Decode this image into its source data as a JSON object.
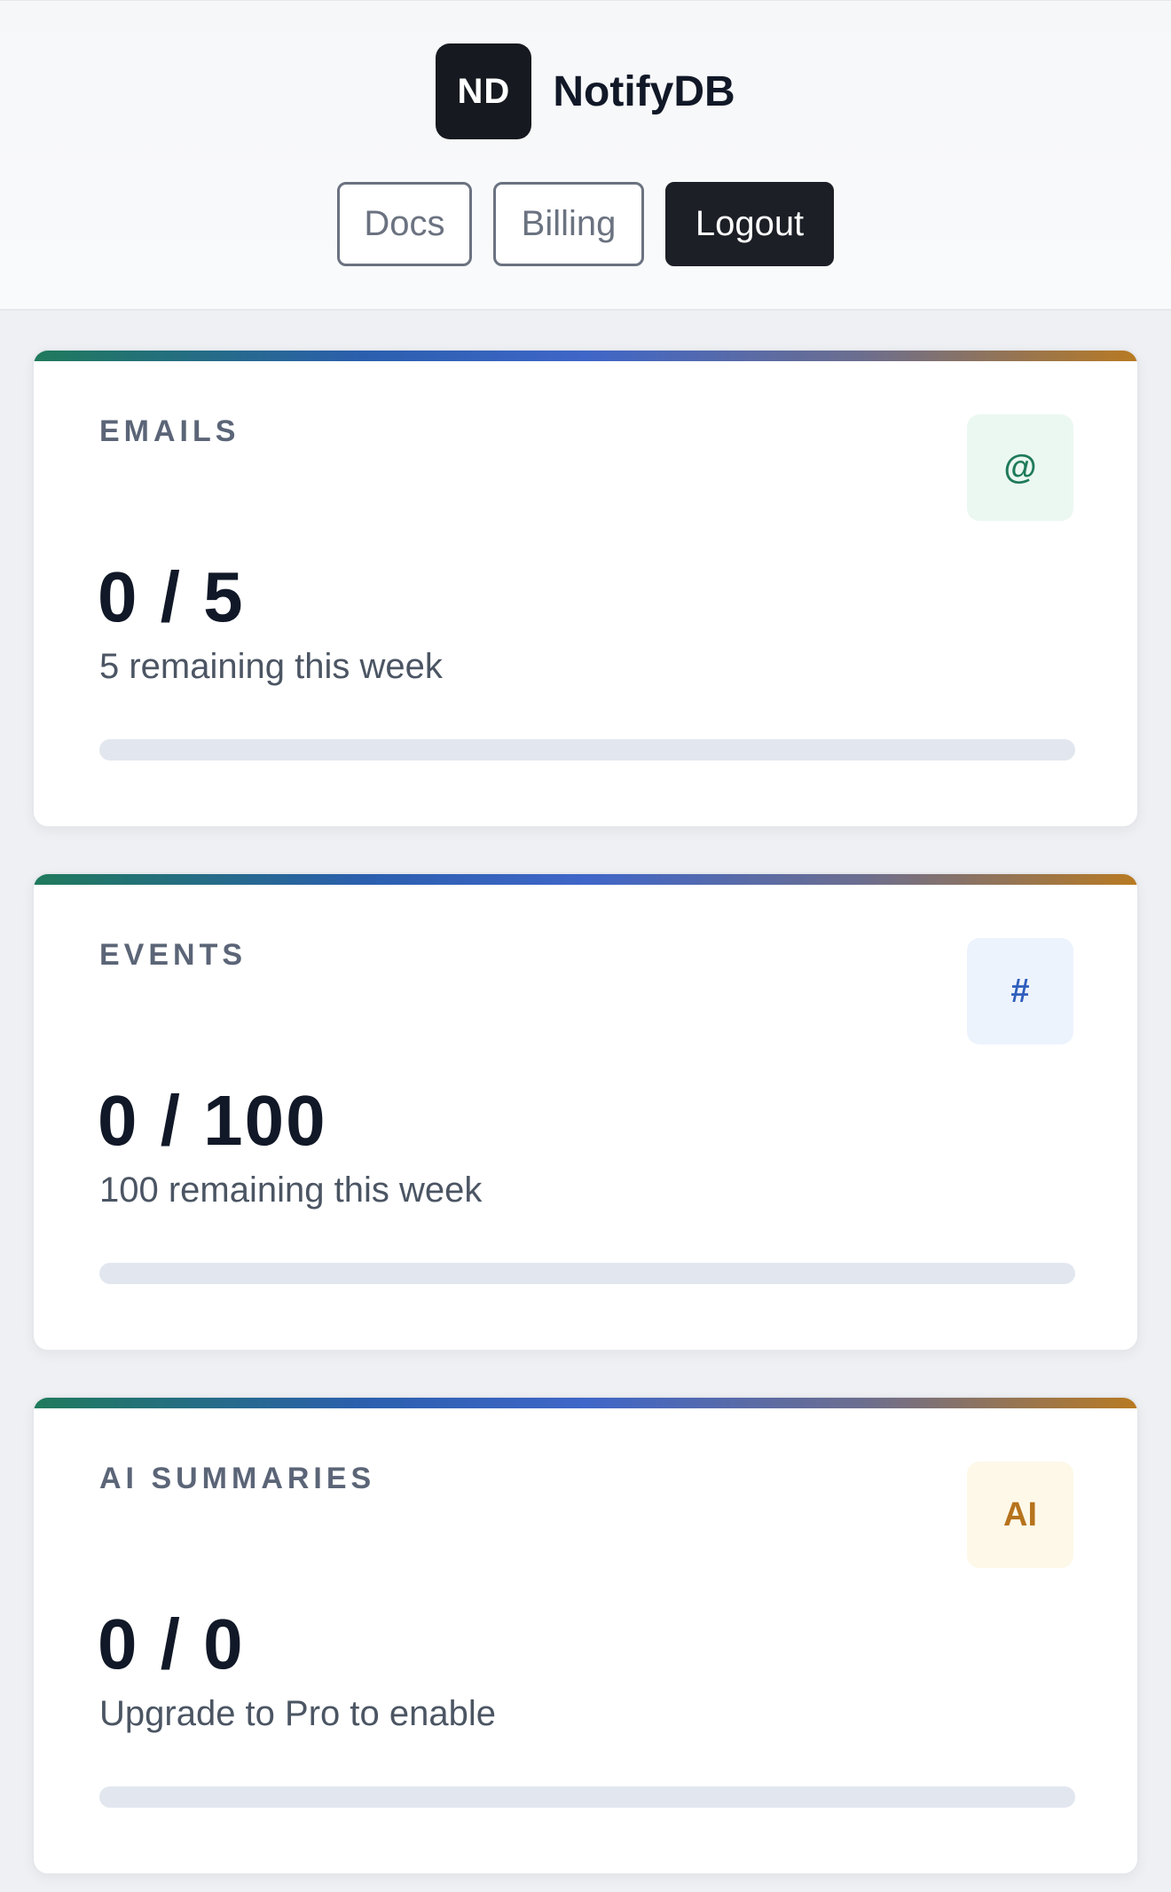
{
  "header": {
    "logo_text": "ND",
    "brand_name": "NotifyDB",
    "nav": {
      "docs": "Docs",
      "billing": "Billing",
      "logout": "Logout"
    }
  },
  "cards": [
    {
      "label": "EMAILS",
      "icon_text": "@",
      "icon_name": "at-icon",
      "value": "0 / 5",
      "subtitle": "5 remaining this week",
      "progress": 0
    },
    {
      "label": "EVENTS",
      "icon_text": "#",
      "icon_name": "hash-icon",
      "value": "0 / 100",
      "subtitle": "100 remaining this week",
      "progress": 0
    },
    {
      "label": "AI SUMMARIES",
      "icon_text": "AI",
      "icon_name": "ai-icon",
      "value": "0 / 0",
      "subtitle": "Upgrade to Pro to enable",
      "progress": 0
    }
  ],
  "colors": {
    "accent_dark": "#1c1f26",
    "emails_accent": "#1f7a5c",
    "events_accent": "#2f5fbd",
    "ai_accent": "#b7731c"
  }
}
